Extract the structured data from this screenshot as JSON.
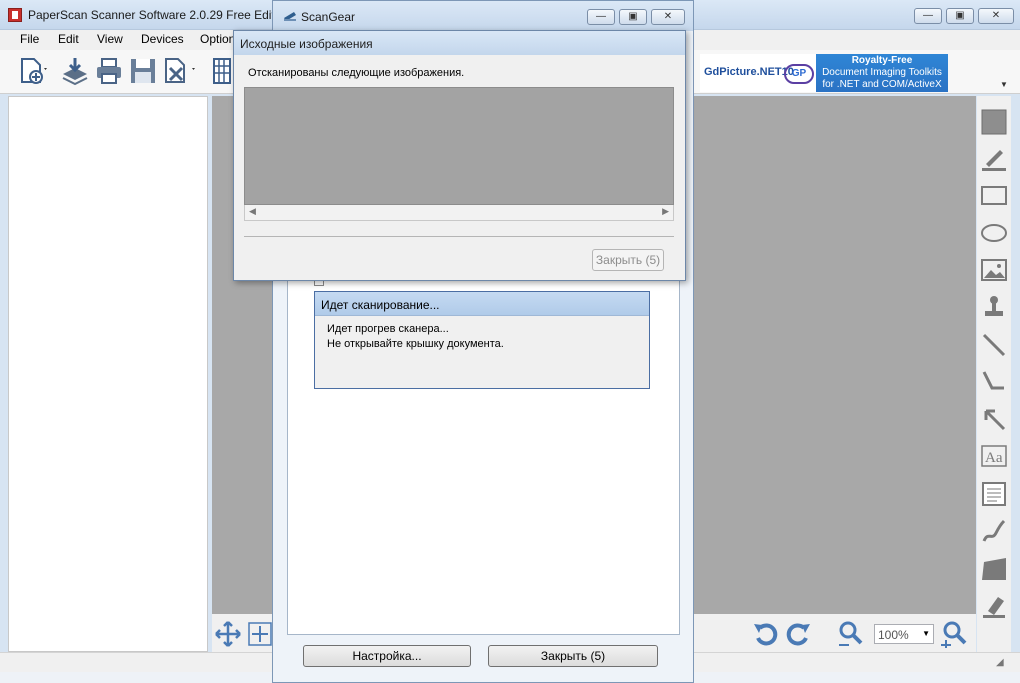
{
  "main_window": {
    "title": "PaperScan Scanner Software 2.0.29 Free Edition",
    "caption_buttons": [
      "minimize-icon",
      "maximize-icon",
      "close-icon"
    ],
    "menu": [
      "File",
      "Edit",
      "View",
      "Devices",
      "Options"
    ],
    "toolbar_icons": [
      "new-document-icon",
      "scan-download-icon",
      "print-icon",
      "save-icon",
      "delete-icon",
      "grid-view-icon"
    ],
    "ad": {
      "brand": "GdPicture.NET10",
      "logo_text": "GP",
      "line1": "Royalty-Free",
      "line2": "Document Imaging Toolkits",
      "line3": "for .NET and COM/ActiveX"
    },
    "right_tools": [
      "rectangle-filled-icon",
      "highlighter-icon",
      "rectangle-icon",
      "ellipse-icon",
      "image-icon",
      "stamp-icon",
      "line-icon",
      "connector-icon",
      "arrow-icon",
      "text-icon",
      "note-icon",
      "freehand-icon",
      "polygon-icon",
      "eraser-icon"
    ],
    "bottom_tools": [
      "move-icon",
      "fit-icon",
      "rotate-left-icon",
      "rotate-right-icon",
      "zoom-out-icon",
      "zoom-in-icon"
    ],
    "zoom_value": "100%"
  },
  "scangear": {
    "title": "ScanGear",
    "settings_button": "Настройка...",
    "close_button": "Закрыть (5)"
  },
  "scanning_dialog": {
    "title": "Идет сканирование...",
    "line1": "Идет прогрев сканера...",
    "line2": "Не открывайте крышку документа."
  },
  "source_dialog": {
    "title": "Исходные изображения",
    "message": "Отсканированы следующие изображения.",
    "close_button": "Закрыть (5)"
  }
}
